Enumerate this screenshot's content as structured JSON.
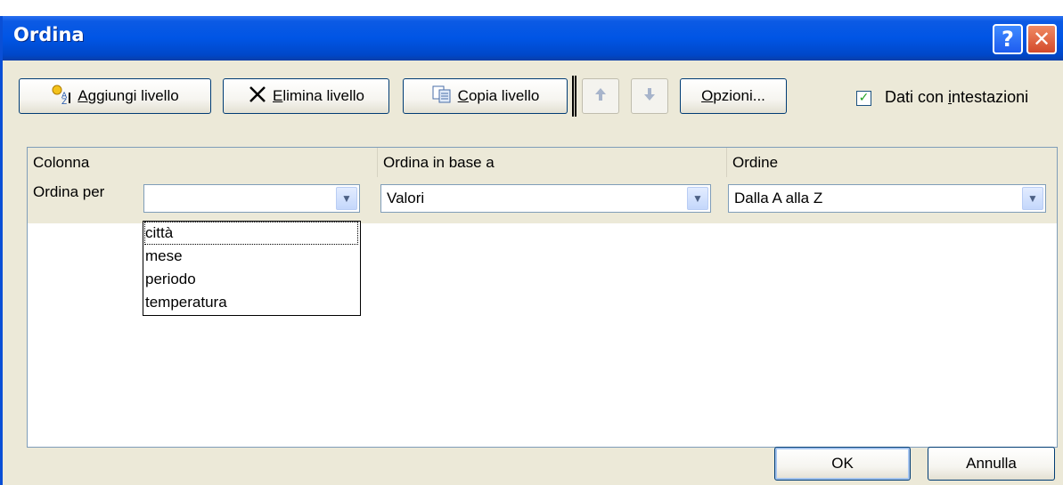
{
  "window": {
    "title": "Ordina"
  },
  "titlebar": {
    "help_label": "?",
    "close_label": "✕"
  },
  "toolbar": {
    "add_level": {
      "label_prefix": "",
      "label_ul": "A",
      "label_rest": "ggiungi livello"
    },
    "delete_level": {
      "label_ul": "E",
      "label_rest": "limina livello"
    },
    "copy_level": {
      "label_ul": "C",
      "label_rest": "opia livello"
    },
    "move_up_icon": "arrow-up-icon",
    "move_down_icon": "arrow-down-icon",
    "options": {
      "label_ul": "O",
      "label_rest": "pzioni..."
    },
    "headers_checkbox": {
      "checked": true,
      "label_before": "Dati con ",
      "label_ul": "i",
      "label_rest": "ntestazioni"
    }
  },
  "grid": {
    "headers": [
      "Colonna",
      "Ordina in base a",
      "Ordine"
    ],
    "row": {
      "label": "Ordina per",
      "column_value": "",
      "sort_on": "Valori",
      "order": "Dalla A alla Z"
    },
    "dropdown_options": [
      "città",
      "mese",
      "periodo",
      "temperatura"
    ]
  },
  "footer": {
    "ok_label": "OK",
    "cancel_label": "Annulla"
  }
}
